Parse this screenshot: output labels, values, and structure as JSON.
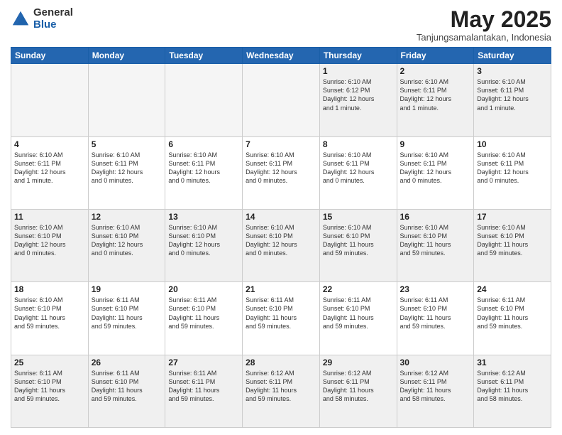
{
  "header": {
    "logo": {
      "line1": "General",
      "line2": "Blue"
    },
    "title": "May 2025",
    "subtitle": "Tanjungsamalantakan, Indonesia"
  },
  "weekdays": [
    "Sunday",
    "Monday",
    "Tuesday",
    "Wednesday",
    "Thursday",
    "Friday",
    "Saturday"
  ],
  "rows": [
    [
      {
        "day": "",
        "empty": true
      },
      {
        "day": "",
        "empty": true
      },
      {
        "day": "",
        "empty": true
      },
      {
        "day": "",
        "empty": true
      },
      {
        "day": "1",
        "info": "Sunrise: 6:10 AM\nSunset: 6:12 PM\nDaylight: 12 hours\nand 1 minute."
      },
      {
        "day": "2",
        "info": "Sunrise: 6:10 AM\nSunset: 6:11 PM\nDaylight: 12 hours\nand 1 minute."
      },
      {
        "day": "3",
        "info": "Sunrise: 6:10 AM\nSunset: 6:11 PM\nDaylight: 12 hours\nand 1 minute."
      }
    ],
    [
      {
        "day": "4",
        "info": "Sunrise: 6:10 AM\nSunset: 6:11 PM\nDaylight: 12 hours\nand 1 minute."
      },
      {
        "day": "5",
        "info": "Sunrise: 6:10 AM\nSunset: 6:11 PM\nDaylight: 12 hours\nand 0 minutes."
      },
      {
        "day": "6",
        "info": "Sunrise: 6:10 AM\nSunset: 6:11 PM\nDaylight: 12 hours\nand 0 minutes."
      },
      {
        "day": "7",
        "info": "Sunrise: 6:10 AM\nSunset: 6:11 PM\nDaylight: 12 hours\nand 0 minutes."
      },
      {
        "day": "8",
        "info": "Sunrise: 6:10 AM\nSunset: 6:11 PM\nDaylight: 12 hours\nand 0 minutes."
      },
      {
        "day": "9",
        "info": "Sunrise: 6:10 AM\nSunset: 6:11 PM\nDaylight: 12 hours\nand 0 minutes."
      },
      {
        "day": "10",
        "info": "Sunrise: 6:10 AM\nSunset: 6:11 PM\nDaylight: 12 hours\nand 0 minutes."
      }
    ],
    [
      {
        "day": "11",
        "info": "Sunrise: 6:10 AM\nSunset: 6:10 PM\nDaylight: 12 hours\nand 0 minutes."
      },
      {
        "day": "12",
        "info": "Sunrise: 6:10 AM\nSunset: 6:10 PM\nDaylight: 12 hours\nand 0 minutes."
      },
      {
        "day": "13",
        "info": "Sunrise: 6:10 AM\nSunset: 6:10 PM\nDaylight: 12 hours\nand 0 minutes."
      },
      {
        "day": "14",
        "info": "Sunrise: 6:10 AM\nSunset: 6:10 PM\nDaylight: 12 hours\nand 0 minutes."
      },
      {
        "day": "15",
        "info": "Sunrise: 6:10 AM\nSunset: 6:10 PM\nDaylight: 11 hours\nand 59 minutes."
      },
      {
        "day": "16",
        "info": "Sunrise: 6:10 AM\nSunset: 6:10 PM\nDaylight: 11 hours\nand 59 minutes."
      },
      {
        "day": "17",
        "info": "Sunrise: 6:10 AM\nSunset: 6:10 PM\nDaylight: 11 hours\nand 59 minutes."
      }
    ],
    [
      {
        "day": "18",
        "info": "Sunrise: 6:10 AM\nSunset: 6:10 PM\nDaylight: 11 hours\nand 59 minutes."
      },
      {
        "day": "19",
        "info": "Sunrise: 6:11 AM\nSunset: 6:10 PM\nDaylight: 11 hours\nand 59 minutes."
      },
      {
        "day": "20",
        "info": "Sunrise: 6:11 AM\nSunset: 6:10 PM\nDaylight: 11 hours\nand 59 minutes."
      },
      {
        "day": "21",
        "info": "Sunrise: 6:11 AM\nSunset: 6:10 PM\nDaylight: 11 hours\nand 59 minutes."
      },
      {
        "day": "22",
        "info": "Sunrise: 6:11 AM\nSunset: 6:10 PM\nDaylight: 11 hours\nand 59 minutes."
      },
      {
        "day": "23",
        "info": "Sunrise: 6:11 AM\nSunset: 6:10 PM\nDaylight: 11 hours\nand 59 minutes."
      },
      {
        "day": "24",
        "info": "Sunrise: 6:11 AM\nSunset: 6:10 PM\nDaylight: 11 hours\nand 59 minutes."
      }
    ],
    [
      {
        "day": "25",
        "info": "Sunrise: 6:11 AM\nSunset: 6:10 PM\nDaylight: 11 hours\nand 59 minutes."
      },
      {
        "day": "26",
        "info": "Sunrise: 6:11 AM\nSunset: 6:10 PM\nDaylight: 11 hours\nand 59 minutes."
      },
      {
        "day": "27",
        "info": "Sunrise: 6:11 AM\nSunset: 6:11 PM\nDaylight: 11 hours\nand 59 minutes."
      },
      {
        "day": "28",
        "info": "Sunrise: 6:12 AM\nSunset: 6:11 PM\nDaylight: 11 hours\nand 59 minutes."
      },
      {
        "day": "29",
        "info": "Sunrise: 6:12 AM\nSunset: 6:11 PM\nDaylight: 11 hours\nand 58 minutes."
      },
      {
        "day": "30",
        "info": "Sunrise: 6:12 AM\nSunset: 6:11 PM\nDaylight: 11 hours\nand 58 minutes."
      },
      {
        "day": "31",
        "info": "Sunrise: 6:12 AM\nSunset: 6:11 PM\nDaylight: 11 hours\nand 58 minutes."
      }
    ]
  ]
}
